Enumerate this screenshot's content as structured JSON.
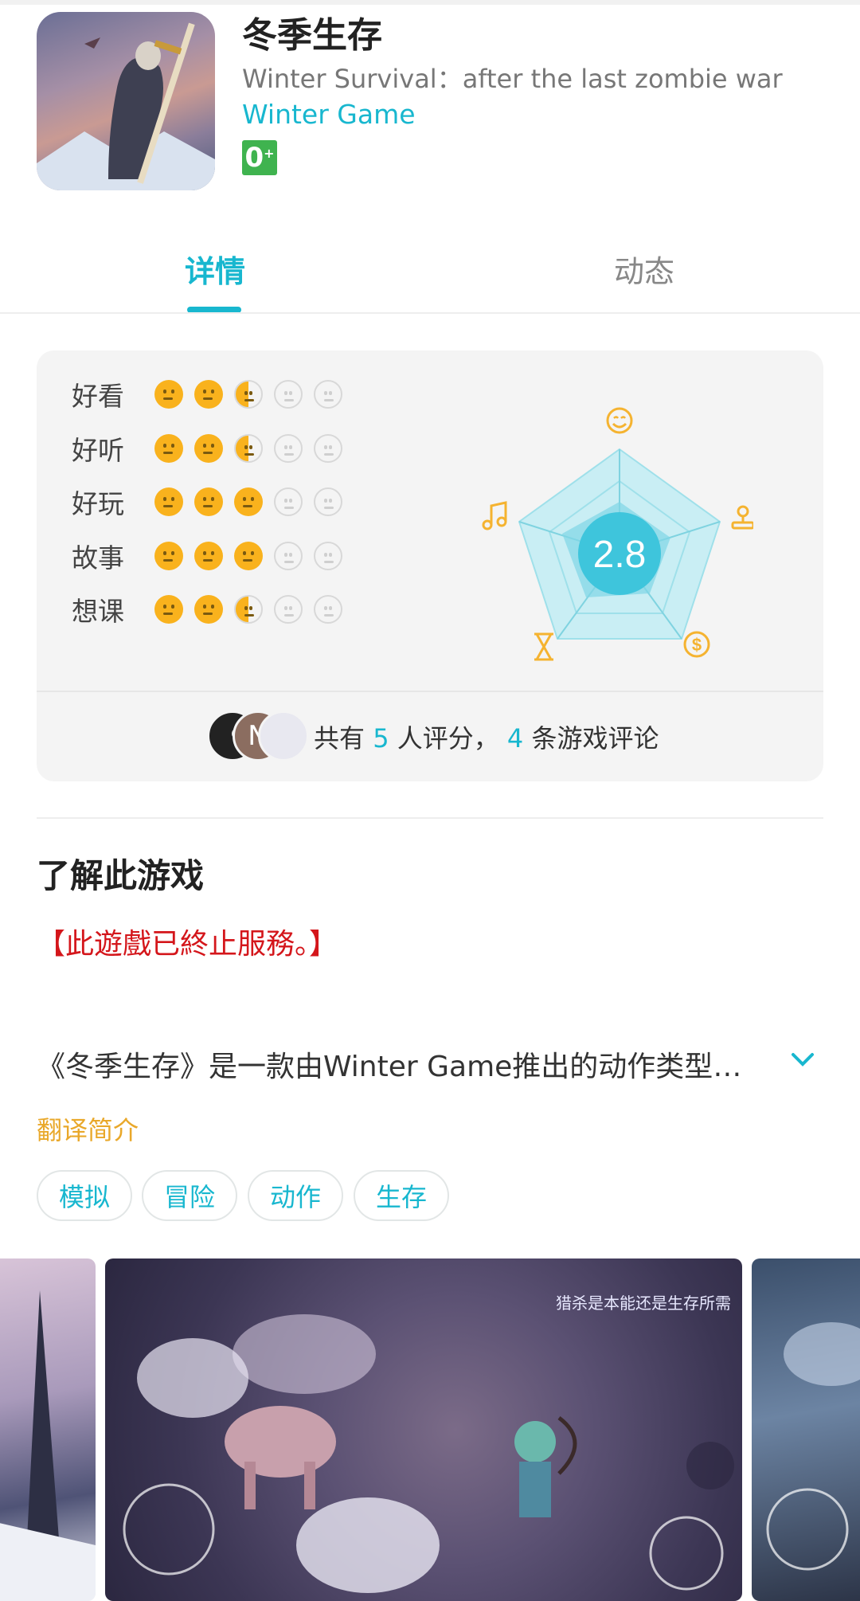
{
  "header": {
    "title": "冬季生存",
    "subtitle": "Winter Survival：after the last zombie war",
    "developer": "Winter Game",
    "age_rating": "0",
    "age_rating_suffix": "+"
  },
  "tabs": [
    {
      "label": "详情",
      "active": true
    },
    {
      "label": "动态",
      "active": false
    }
  ],
  "rating": {
    "score": "2.8",
    "categories": [
      {
        "label": "好看",
        "level": 2.5
      },
      {
        "label": "好听",
        "level": 2.5
      },
      {
        "label": "好玩",
        "level": 3
      },
      {
        "label": "故事",
        "level": 3
      },
      {
        "label": "想课",
        "level": 2.5
      }
    ],
    "max": 5,
    "summary": {
      "prefix": "共有",
      "raters": "5",
      "middle": "人评分，",
      "reviews": "4",
      "suffix": "条游戏评论"
    },
    "avatar_initial": "N"
  },
  "about": {
    "title": "了解此游戏",
    "notice": "【此遊戲已終止服務。】",
    "description": "《冬季生存》是一款由Winter Game推出的动作类型游戏",
    "translate_label": "翻译简介"
  },
  "tags": [
    "模拟",
    "冒险",
    "动作",
    "生存"
  ],
  "screenshots": {
    "caption": "猎杀是本能还是生存所需"
  },
  "colors": {
    "accent": "#18b7cf",
    "star": "#f9b21d",
    "notice": "#d4161b",
    "translate": "#e9a82a"
  }
}
